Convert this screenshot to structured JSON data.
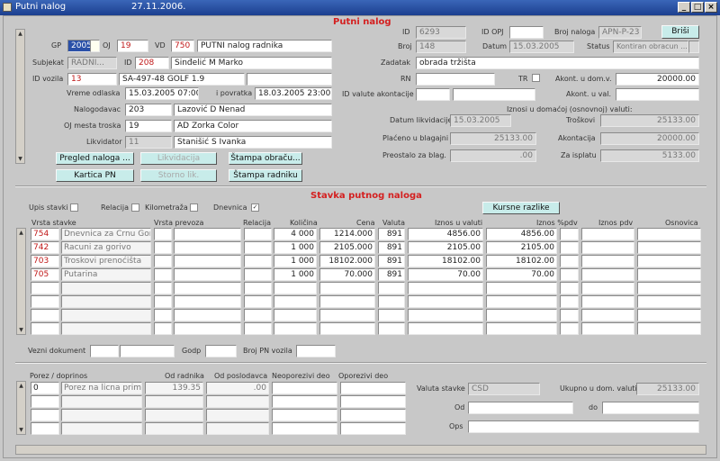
{
  "window": {
    "title": "Putni nalog",
    "date": "27.11.2006.",
    "min": "_",
    "max": "□",
    "close": "×"
  },
  "header_section": {
    "title": "Putni nalog"
  },
  "header": {
    "gp_label": "GP",
    "gp": "2005",
    "oj_label": "OJ",
    "oj": "19",
    "vd_label": "VD",
    "vd": "750",
    "vd_name": "PUTNI nalog radnika",
    "subjekat_label": "Subjekat",
    "subjekat": "RADNI...",
    "id_label": "ID",
    "id_val": "208",
    "radnik": "Sinđelić M Marko",
    "vozilo_label": "ID vozila",
    "vozilo_id": "13",
    "vozilo_naziv": "SA-497-48 GOLF 1.9",
    "odlaska_label": "Vreme odlaska",
    "odlaska": "15.03.2005 07:00",
    "povratka_label": "i povratka",
    "povratka": "18.03.2005 23:00",
    "nalogodavac_label": "Nalogodavac",
    "nalogodavac_id": "203",
    "nalogodavac": "Lazović D Nenad",
    "ojmt_label": "OJ mesta troska",
    "ojmt_id": "19",
    "ojmt": "AD Zorka Color",
    "likvidator_label": "Likvidator",
    "likvidator_id": "11",
    "likvidator": "Stanišić S Ivanka",
    "rid_label": "ID",
    "rid": "6293",
    "idopj_label": "ID OPJ",
    "idopj": "",
    "brnal_label": "Broj naloga",
    "brnal": "APN-P-23",
    "broj_label": "Broj",
    "broj": "148",
    "datum_label": "Datum",
    "datum": "15.03.2005",
    "status_label": "Status",
    "status": "Kontiran obracun ...",
    "zadatak_label": "Zadatak",
    "zadatak": "obrada tržišta",
    "rn_label": "RN",
    "rn": "",
    "tr_label": "TR",
    "akont_dom_label": "Akont. u dom.v.",
    "akont_dom": "20000.00",
    "idval_label": "ID valute akontacije",
    "idval": "",
    "akont_val_label": "Akont. u val.",
    "akont_val": "",
    "iznosi_label": "Iznosi u domaćoj (osnovnoj) valuti:",
    "datlik_label": "Datum likvidacije",
    "datlik": "15.03.2005",
    "troskovi_label": "Troškovi",
    "troskovi": "25133.00",
    "placeno_label": "Plaćeno u blagajni",
    "placeno": "25133.00",
    "akontacija_label": "Akontacija",
    "akontacija": "20000.00",
    "preostalo_label": "Preostalo za blag.",
    "preostalo": ".00",
    "zaisplatu_label": "Za isplatu",
    "zaisplatu": "5133.00"
  },
  "buttons": {
    "brisi": "Briši",
    "pregled": "Pregled naloga ...",
    "likvidacija": "Likvidacija",
    "stampa_obr": "Štampa obraču...",
    "kartica": "Kartica PN",
    "storno": "Storno lik.",
    "stampa_rad": "Štampa radniku",
    "kursne": "Kursne razlike"
  },
  "stavka_section": {
    "title": "Stavka putnog naloga"
  },
  "checks": {
    "upis": "Upis stavki",
    "relacija": "Relacija",
    "kilometraza": "Kilometraža",
    "dnevnica": "Dnevnica",
    "dnevnica_mark": "✓"
  },
  "cols": [
    "Vrsta stavke",
    "Vrsta prevoza",
    "Relacija",
    "Količina",
    "Cena",
    "Valuta",
    "Iznos u valuti",
    "Iznos %pdv",
    "Iznos pdv",
    "Osnovica"
  ],
  "rows": [
    {
      "code": "754",
      "name": "Dnevnica za Crnu Gor",
      "kol": "4 000",
      "cena": "1214.000",
      "val": "891",
      "izv": "4856.00",
      "izp": "4856.00"
    },
    {
      "code": "742",
      "name": "Racuni za gorivo",
      "kol": "1 000",
      "cena": "2105.000",
      "val": "891",
      "izv": "2105.00",
      "izp": "2105.00"
    },
    {
      "code": "703",
      "name": "Troskovi prenoćišta",
      "kol": "1 000",
      "cena": "18102.000",
      "val": "891",
      "izv": "18102.00",
      "izp": "18102.00"
    },
    {
      "code": "705",
      "name": "Putarina",
      "kol": "1 000",
      "cena": "70.000",
      "val": "891",
      "izv": "70.00",
      "izp": "70.00"
    }
  ],
  "footer1": {
    "vezni_label": "Vezni dokument",
    "godp_label": "Godp",
    "brpn_label": "Broj PN vozila"
  },
  "porez": {
    "cols": [
      "Porez / doprinos",
      "Od radnika",
      "Od poslodavca",
      "Neoporezivi deo",
      "Oporezivi deo"
    ],
    "row": {
      "code": "0",
      "name": "Porez na licna prim",
      "od_radnika": "139.35",
      "od_posl": ".00"
    }
  },
  "footer2": {
    "valuta_label": "Valuta stavke",
    "valuta": "CSD",
    "ukupno_label": "Ukupno u dom. valuti",
    "ukupno": "25133.00",
    "od_label": "Od",
    "do_label": "do",
    "ops_label": "Ops"
  }
}
